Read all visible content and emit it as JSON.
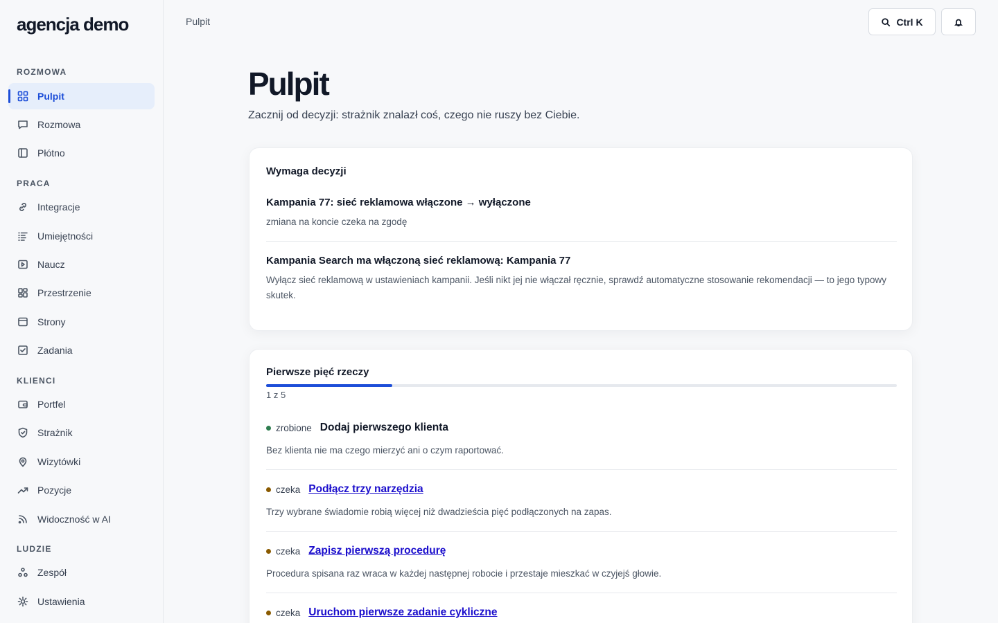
{
  "brand": "agencja demo",
  "sidebar": {
    "sections": [
      {
        "label": "ROZMOWA",
        "items": [
          {
            "label": "Pulpit",
            "icon": "grid-icon",
            "active": true
          },
          {
            "label": "Rozmowa",
            "icon": "chat-icon"
          },
          {
            "label": "Płótno",
            "icon": "canvas-icon"
          }
        ]
      },
      {
        "label": "PRACA",
        "items": [
          {
            "label": "Integracje",
            "icon": "link-icon"
          },
          {
            "label": "Umiejętności",
            "icon": "list-icon"
          },
          {
            "label": "Naucz",
            "icon": "play-icon"
          },
          {
            "label": "Przestrzenie",
            "icon": "spaces-icon"
          },
          {
            "label": "Strony",
            "icon": "browser-icon"
          },
          {
            "label": "Zadania",
            "icon": "checkbox-icon"
          }
        ]
      },
      {
        "label": "KLIENCI",
        "items": [
          {
            "label": "Portfel",
            "icon": "wallet-icon"
          },
          {
            "label": "Strażnik",
            "icon": "shield-icon"
          },
          {
            "label": "Wizytówki",
            "icon": "pin-icon"
          },
          {
            "label": "Pozycje",
            "icon": "trend-icon"
          },
          {
            "label": "Widoczność w AI",
            "icon": "signal-icon"
          }
        ]
      },
      {
        "label": "LUDZIE",
        "items": [
          {
            "label": "Zespół",
            "icon": "team-icon"
          },
          {
            "label": "Ustawienia",
            "icon": "settings-icon"
          }
        ]
      }
    ]
  },
  "header": {
    "breadcrumb": "Pulpit",
    "search_label": "Ctrl K"
  },
  "main": {
    "title": "Pulpit",
    "subtitle": "Zacznij od decyzji: strażnik znalazł coś, czego nie ruszy bez Ciebie.",
    "decisions": {
      "title": "Wymaga decyzji",
      "items": [
        {
          "title": "Kampania 77: sieć reklamowa włączone → wyłączone",
          "desc": "zmiana na koncie czeka na zgodę"
        },
        {
          "title": "Kampania Search ma włączoną sieć reklamową: Kampania 77",
          "desc": "Wyłącz sieć reklamową w ustawieniach kampanii. Jeśli nikt jej nie włączał ręcznie, sprawdź automatyczne stosowanie rekomendacji — to jego typowy skutek."
        }
      ]
    },
    "onboarding": {
      "title": "Pierwsze pięć rzeczy",
      "progress_label": "1 z 5",
      "progress_fraction": 0.2,
      "steps": [
        {
          "status": "zrobione",
          "status_color": "#2e7d4f",
          "title": "Dodaj pierwszego klienta",
          "desc": "Bez klienta nie ma czego mierzyć ani o czym raportować.",
          "link": false
        },
        {
          "status": "czeka",
          "status_color": "#8a5a00",
          "title": "Podłącz trzy narzędzia",
          "desc": "Trzy wybrane świadomie robią więcej niż dwadzieścia pięć podłączonych na zapas.",
          "link": true
        },
        {
          "status": "czeka",
          "status_color": "#8a5a00",
          "title": "Zapisz pierwszą procedurę",
          "desc": "Procedura spisana raz wraca w każdej następnej robocie i przestaje mieszkać w czyjejś głowie.",
          "link": true
        },
        {
          "status": "czeka",
          "status_color": "#8a5a00",
          "title": "Uruchom pierwsze zadanie cykliczne",
          "desc": "",
          "link": true
        }
      ]
    }
  }
}
